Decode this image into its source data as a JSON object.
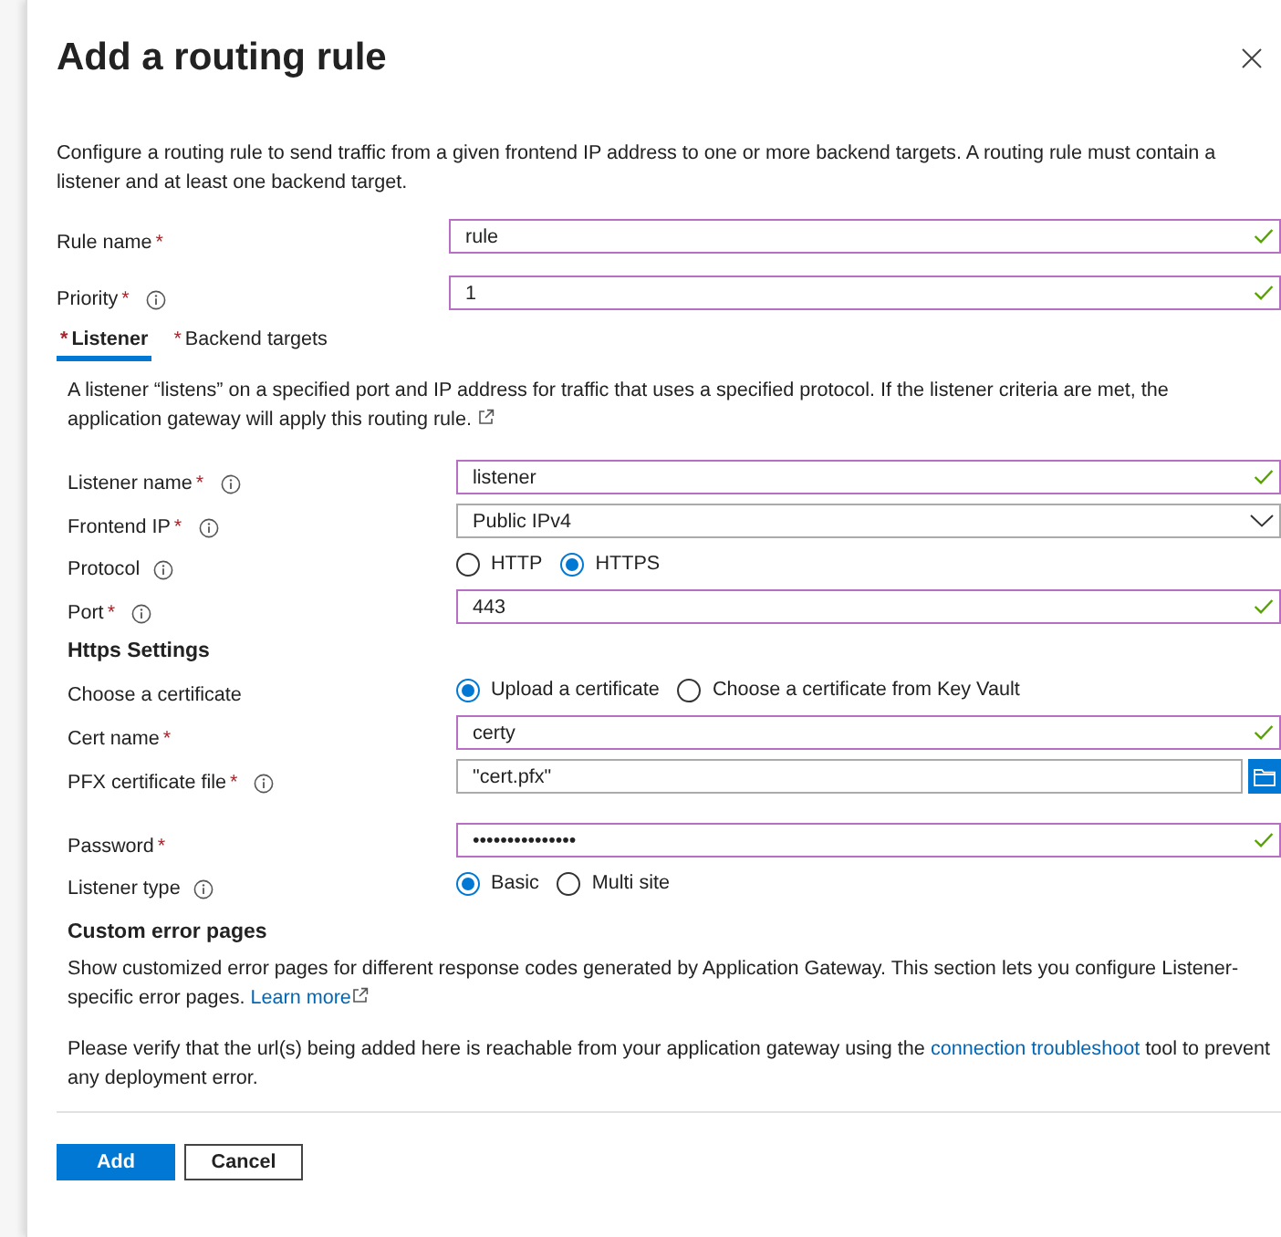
{
  "panel": {
    "title": "Add a routing rule",
    "description": "Configure a routing rule to send traffic from a given frontend IP address to one or more backend targets. A routing rule must contain a listener and at least one backend target."
  },
  "fields": [
    {
      "kind": "text",
      "label": "Rule name",
      "required_mark": "*",
      "value": "rule",
      "valid": true
    },
    {
      "kind": "text",
      "label": "Priority",
      "required_mark": "*",
      "info": true,
      "value": "1",
      "valid": true
    }
  ],
  "tabs": [
    {
      "label": "Listener",
      "required_mark": "*",
      "selected": true
    },
    {
      "label": "Backend targets",
      "required_mark": "*",
      "selected": false
    }
  ],
  "listener": {
    "description": "A listener “listens” on a specified port and IP address for traffic that uses a specified protocol. If the listener criteria are met, the application gateway will apply this routing rule.",
    "fields": [
      {
        "kind": "text",
        "label": "Listener name",
        "required_mark": "*",
        "info": true,
        "value": "listener",
        "valid": true
      },
      {
        "kind": "select",
        "label": "Frontend IP",
        "required_mark": "*",
        "info": true,
        "value": "Public IPv4"
      },
      {
        "kind": "radio",
        "label": "Protocol",
        "info": true,
        "options": [
          {
            "label": "HTTP",
            "selected": false
          },
          {
            "label": "HTTPS",
            "selected": true
          }
        ]
      },
      {
        "kind": "text",
        "label": "Port",
        "required_mark": "*",
        "info": true,
        "value": "443",
        "valid": true
      }
    ],
    "https_heading": "Https Settings",
    "https_fields": [
      {
        "kind": "radio",
        "label": "Choose a certificate",
        "options": [
          {
            "label": "Upload a certificate",
            "selected": true
          },
          {
            "label": "Choose a certificate from Key Vault",
            "selected": false
          }
        ]
      },
      {
        "kind": "text",
        "label": "Cert name",
        "required_mark": "*",
        "value": "certy",
        "valid": true
      },
      {
        "kind": "file",
        "label": "PFX certificate file",
        "required_mark": "*",
        "info": true,
        "value": "\"cert.pfx\""
      },
      {
        "kind": "password",
        "label": "Password",
        "required_mark": "*",
        "value": "•••••••••••••••",
        "valid": true
      },
      {
        "kind": "radio",
        "label": "Listener type",
        "info": true,
        "options": [
          {
            "label": "Basic",
            "selected": true
          },
          {
            "label": "Multi site",
            "selected": false
          }
        ]
      }
    ],
    "custom_errors": {
      "heading": "Custom error pages",
      "text": "Show customized error pages for different response codes generated by Application Gateway. This section lets you configure Listener-specific error pages.",
      "link": "Learn more",
      "verify_before": "Please verify that the url(s) being added here is reachable from your application gateway using the",
      "verify_link": "connection troubleshoot",
      "verify_after": "tool to prevent any deployment error."
    }
  },
  "buttons": [
    {
      "kind": "primary",
      "label": "Add"
    },
    {
      "kind": "secondary",
      "label": "Cancel"
    }
  ]
}
